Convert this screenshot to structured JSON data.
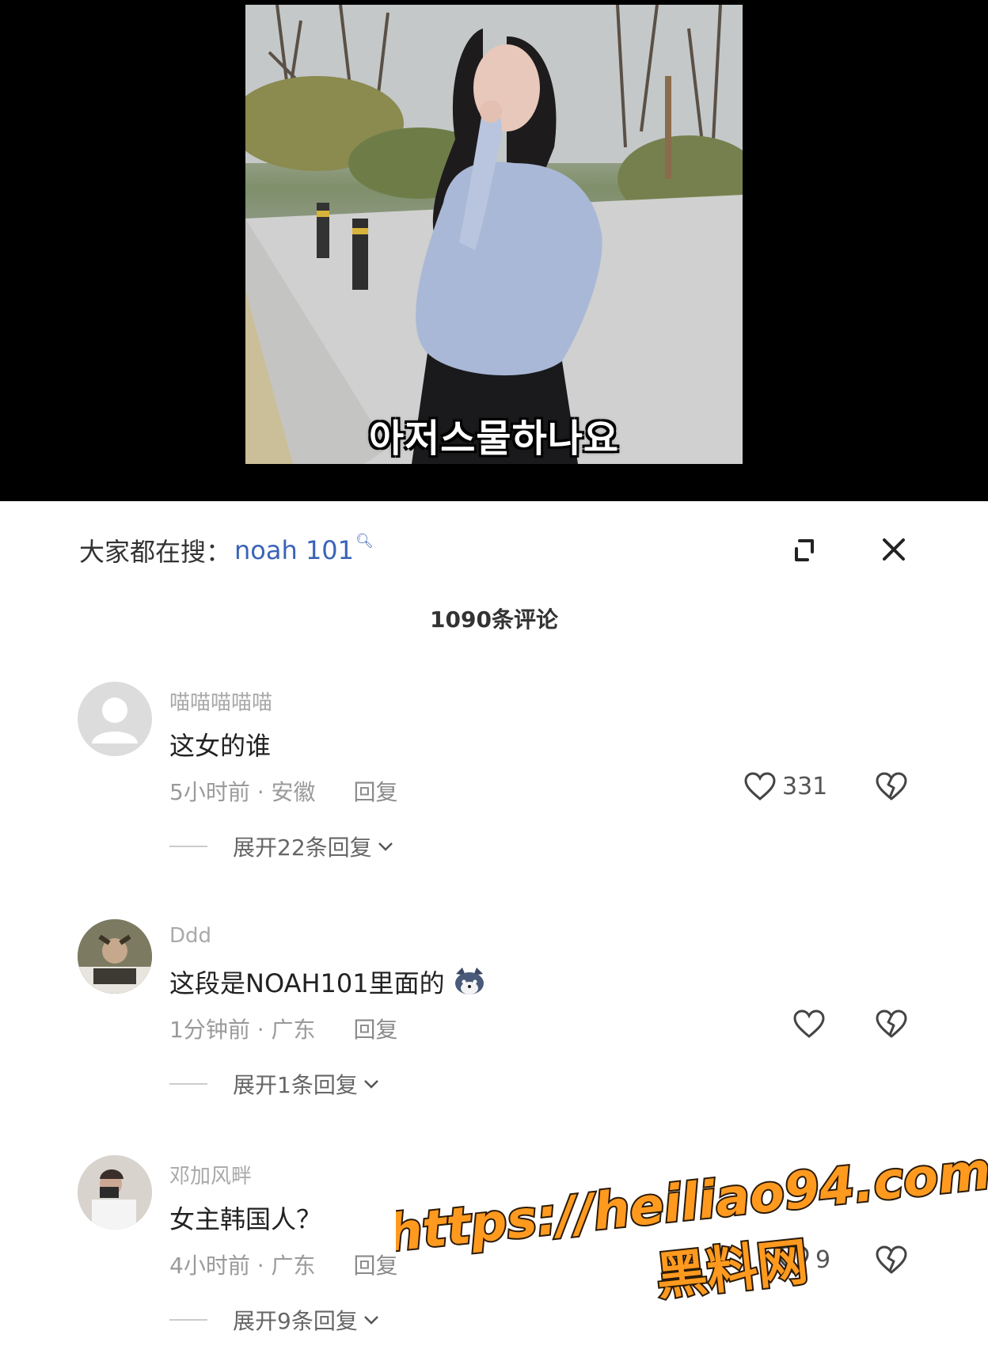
{
  "video": {
    "subtitle": "아저스물하나요"
  },
  "header": {
    "search_prefix": "大家都在搜：",
    "search_term": "noah 101"
  },
  "comment_count": "1090条评论",
  "comments": [
    {
      "username": "喵喵喵喵喵",
      "text": "这女的谁",
      "time_location": "5小时前 · 安徽",
      "reply_label": "回复",
      "likes": "331",
      "expand_label": "展开22条回复"
    },
    {
      "username": "Ddd",
      "text": "这段是NOAH101里面的",
      "time_location": "1分钟前 · 广东",
      "reply_label": "回复",
      "likes": "",
      "expand_label": "展开1条回复"
    },
    {
      "username": "邓加风畔",
      "text": "女主韩国人？",
      "time_location": "4小时前 · 广东",
      "reply_label": "回复",
      "likes": "9",
      "expand_label": "展开9条回复"
    }
  ],
  "watermark": {
    "url": "https://heiliao94.com",
    "name": "黑料网",
    "color": "#ff9a1f"
  },
  "colors": {
    "accent_blue": "#3a64b6",
    "muted_gray": "#9a9a9a"
  }
}
